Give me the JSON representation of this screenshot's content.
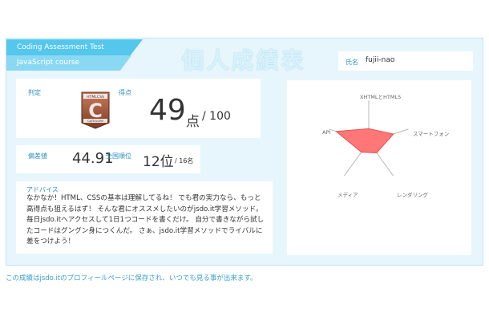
{
  "header": {
    "test_title": "Coding Assessment Test",
    "course": "JavaScript course",
    "page_title": "個人成績表"
  },
  "name_card": {
    "label": "氏名",
    "value": "fujii-nao"
  },
  "score_card": {
    "judgement_label": "判定",
    "badge_text_top": "HTMLCSS",
    "badge_letter": "C",
    "badge_text_bottom": "CATEGORY",
    "score_label": "得点",
    "score": "49",
    "score_unit": "点",
    "score_max": "/ 100"
  },
  "deviation_card": {
    "deviation_label": "偏差値",
    "deviation": "44.91",
    "rank_label": "全国順位",
    "rank": "12位",
    "rank_total": "/ 16名"
  },
  "advice_card": {
    "label": "アドバイス",
    "text": "なかなか！HTML、CSSの基本は理解してるね！ でも君の実力なら、もっと高得点も狙えるはず！ そんな君にオススメしたいのがjsdo.it学習メソッド。 毎日jsdo.itへアクセスして1日1つコードを書くだけ。 自分で書きながら試したコードはグングン身につくんだ。 さぁ、jsdo.it学習メソッドでライバルに差をつけよう！"
  },
  "radar": {
    "axes": [
      "XHTMLとHTML5",
      "スマートフォン",
      "レンダリング",
      "メディア",
      "API"
    ],
    "values": [
      0.32,
      0.62,
      0.32,
      0.3,
      0.82
    ],
    "fill_color": "#ff7070"
  },
  "footer": {
    "text": "この成績はjsdo.itのプロフィールページに保存され、いつでも見る事が出来ます。"
  },
  "colors": {
    "accent": "#55c6ec",
    "label": "#2f8fbf",
    "frame": "#e6f6fc"
  }
}
